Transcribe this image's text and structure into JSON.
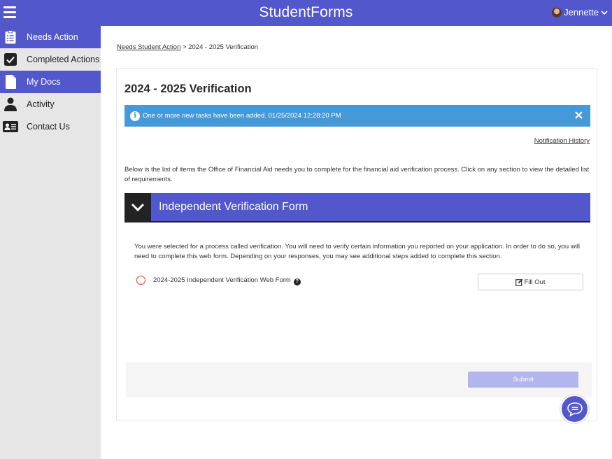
{
  "app": {
    "title": "StudentForms",
    "user_name": "Jennette"
  },
  "sidebar": {
    "items": [
      {
        "label": "Needs Action",
        "icon": "clipboard-icon",
        "active": true
      },
      {
        "label": "Completed Actions",
        "icon": "checkbox-icon",
        "active": false
      },
      {
        "label": "My Docs",
        "icon": "document-icon",
        "active": true
      },
      {
        "label": "Activity",
        "icon": "person-icon",
        "active": false
      },
      {
        "label": "Contact Us",
        "icon": "contact-card-icon",
        "active": false
      }
    ]
  },
  "breadcrumb": {
    "link": "Needs Student Action",
    "separator": ">",
    "current": "2024 - 2025 Verification"
  },
  "page": {
    "title": "2024 - 2025 Verification",
    "alert_message": "One or more new tasks have been added. 01/25/2024 12:28:20 PM",
    "notification_link": "Notification History",
    "intro": "Below is the list of items the Office of Financial Aid needs you to complete for the financial aid verification process. Click on any section to view the detailed list of requirements."
  },
  "section": {
    "title": "Independent Verification Form",
    "description": "You were selected for a process called verification. You will need to verify certain information you reported on your application. In order to do so, you will need to complete this web form. Depending on your responses, you may see additional steps added to complete this section.",
    "task": {
      "label": "2024-2025 Independent Verification Web Form",
      "help": "?",
      "action_label": "Fill Out"
    }
  },
  "footer": {
    "submit_label": "Submit"
  },
  "colors": {
    "brand": "#5257cc",
    "alert": "#4599d9",
    "sidebar_bg": "#e6e6e6",
    "incomplete": "#d63a3a",
    "submit_disabled": "#b3b6ec"
  }
}
